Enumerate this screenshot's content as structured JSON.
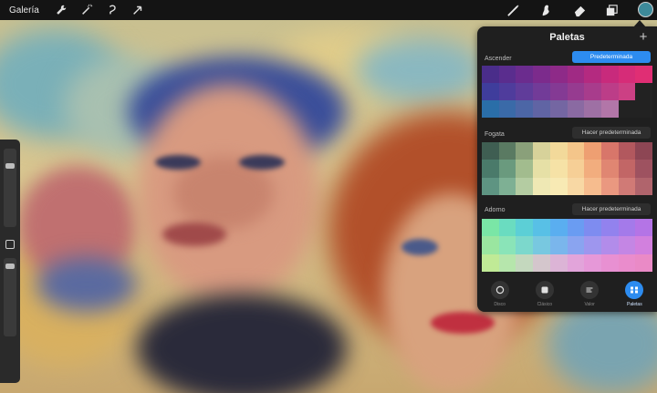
{
  "topbar": {
    "gallery_label": "Galería",
    "left_tools": [
      "wrench-icon",
      "magic-wand-icon",
      "selection-icon",
      "transform-arrow-icon"
    ],
    "right_tools": [
      "brush-icon",
      "smudge-icon",
      "eraser-icon",
      "layers-icon"
    ],
    "current_color": "#3d8a9a"
  },
  "panel": {
    "title": "Paletas",
    "add_label": "+",
    "palettes": [
      {
        "name": "Ascender",
        "button_label": "Predeterminada",
        "is_default": true,
        "rows": [
          [
            "#4a2d8a",
            "#5a2d8e",
            "#6b2c8e",
            "#7c2b8c",
            "#8e2a88",
            "#a02a84",
            "#b42a80",
            "#c82a7c",
            "#d62c78",
            "#e02e74"
          ],
          [
            "#3f3d9c",
            "#4f3c9c",
            "#603c9a",
            "#723b98",
            "#843a94",
            "#963b90",
            "#a83c8c",
            "#bc3d88",
            "#cc4084",
            "#222222"
          ],
          [
            "#2a6ea8",
            "#3a6aa8",
            "#4c66a6",
            "#6064a4",
            "#7466a2",
            "#8a6aa2",
            "#9e70a4",
            "#b276a8",
            "#222222",
            "#222222"
          ]
        ]
      },
      {
        "name": "Fogata",
        "button_label": "Hacer predeterminada",
        "is_default": false,
        "rows": [
          [
            "#3f5e52",
            "#5a7a62",
            "#8aa07a",
            "#d7d29a",
            "#f2d99a",
            "#f4c58a",
            "#ee9f72",
            "#d8766a",
            "#b2585e",
            "#8d4654"
          ],
          [
            "#4a7a6a",
            "#6a9a7e",
            "#a2bc8e",
            "#e6e0a6",
            "#f6e2a6",
            "#f6cf96",
            "#f2ad7e",
            "#e08672",
            "#c26666",
            "#9e5260"
          ],
          [
            "#5e9482",
            "#7eb094",
            "#b4cca2",
            "#efe8b4",
            "#f8eab4",
            "#f8d8a4",
            "#f6bc8e",
            "#ea9880",
            "#d07a76",
            "#b0646c"
          ]
        ]
      },
      {
        "name": "Adorno",
        "button_label": "Hacer predeterminada",
        "is_default": false,
        "rows": [
          [
            "#7ae6a6",
            "#6adcc0",
            "#5ccfd6",
            "#58c0e6",
            "#5aaef0",
            "#6a9cf2",
            "#7e8cf0",
            "#9282ee",
            "#a47aea",
            "#b474e6"
          ],
          [
            "#9ae6a0",
            "#8ae4b8",
            "#7cd8cc",
            "#78c8e0",
            "#7ab6ec",
            "#8aa4f0",
            "#9e96ee",
            "#b28cea",
            "#c486e4",
            "#d280de"
          ],
          [
            "#c0ea96",
            "#b6e6ac",
            "#c4d8be",
            "#d4c6cc",
            "#dcb4d6",
            "#e2a4da",
            "#e698d8",
            "#e890d2",
            "#ea8ccc",
            "#ea8ac6"
          ]
        ]
      }
    ],
    "tabs": [
      {
        "label": "Disco",
        "icon": "disc-icon",
        "active": false
      },
      {
        "label": "Clásico",
        "icon": "square-icon",
        "active": false
      },
      {
        "label": "Valor",
        "icon": "sliders-icon",
        "active": false
      },
      {
        "label": "Paletas",
        "icon": "palettes-icon",
        "active": true
      }
    ]
  }
}
